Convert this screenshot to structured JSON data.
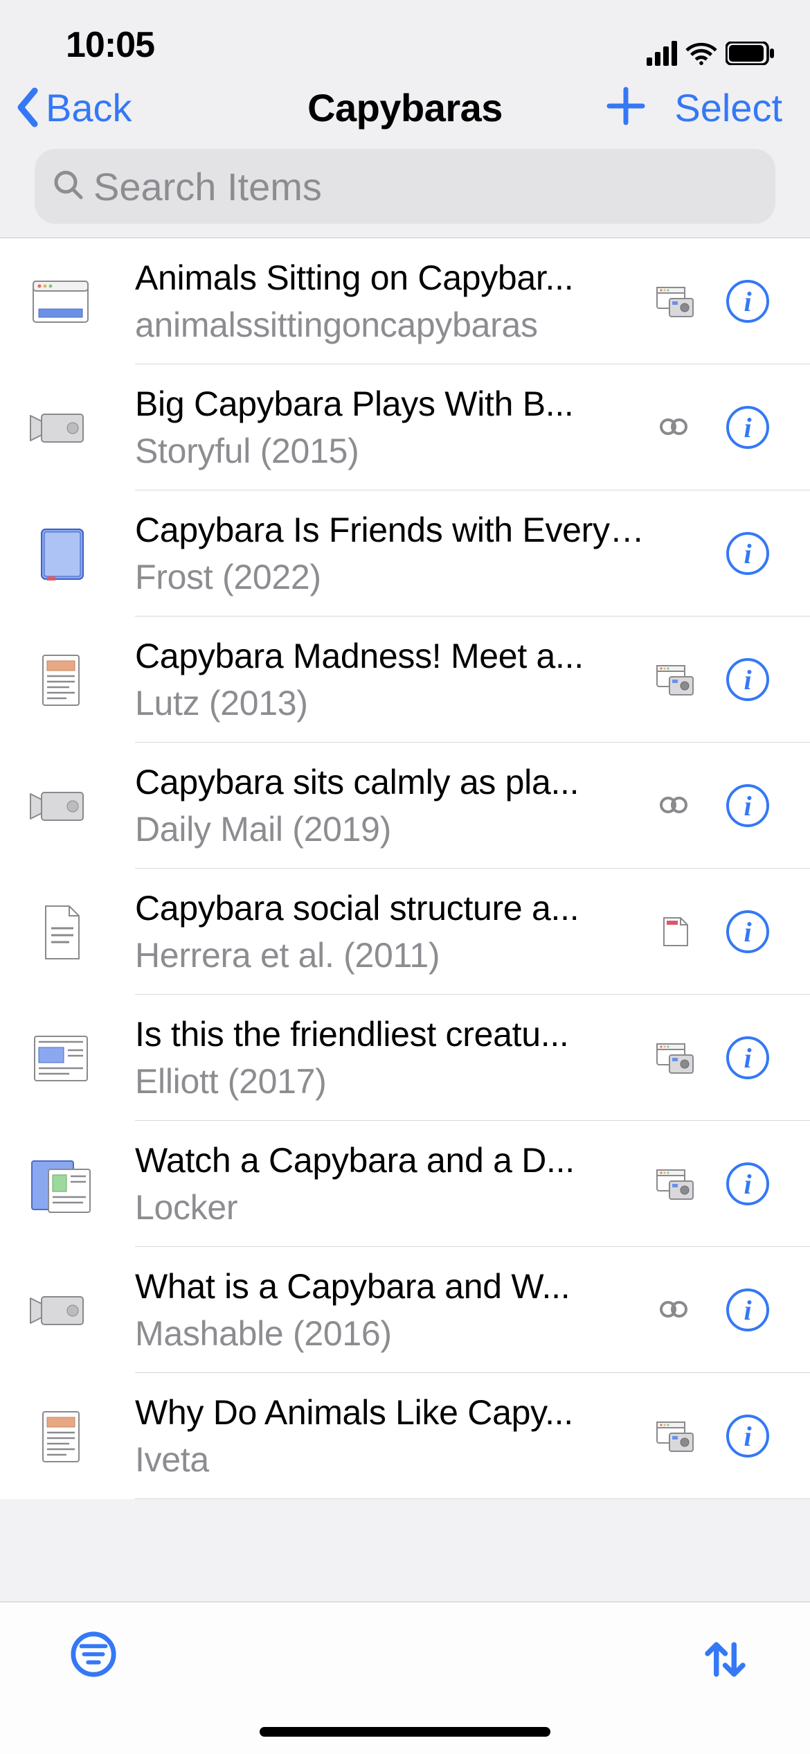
{
  "statusbar": {
    "time": "10:05"
  },
  "nav": {
    "back": "Back",
    "title": "Capybaras",
    "select": "Select"
  },
  "search": {
    "placeholder": "Search Items"
  },
  "items": [
    {
      "title": "Animals Sitting on Capybar...",
      "subtitle": "animalssittingoncapybaras",
      "thumb": "webpage",
      "att": "snapshot"
    },
    {
      "title": "Big Capybara Plays With B...",
      "subtitle": "Storyful (2015)",
      "thumb": "video",
      "att": "link"
    },
    {
      "title": "Capybara Is Friends with Everyone",
      "subtitle": "Frost (2022)",
      "thumb": "book",
      "att": "none"
    },
    {
      "title": "Capybara Madness! Meet a...",
      "subtitle": "Lutz (2013)",
      "thumb": "article",
      "att": "snapshot"
    },
    {
      "title": "Capybara sits calmly as pla...",
      "subtitle": "Daily Mail (2019)",
      "thumb": "video",
      "att": "link"
    },
    {
      "title": "Capybara social structure a...",
      "subtitle": "Herrera et al. (2011)",
      "thumb": "document",
      "att": "pdf"
    },
    {
      "title": "Is this the friendliest creatu...",
      "subtitle": "Elliott (2017)",
      "thumb": "news",
      "att": "snapshot"
    },
    {
      "title": "Watch a Capybara and a D...",
      "subtitle": "Locker",
      "thumb": "news-alt",
      "att": "snapshot"
    },
    {
      "title": "What is a Capybara and W...",
      "subtitle": "Mashable (2016)",
      "thumb": "video",
      "att": "link"
    },
    {
      "title": "Why Do Animals Like Capy...",
      "subtitle": "Iveta",
      "thumb": "article",
      "att": "snapshot"
    }
  ]
}
